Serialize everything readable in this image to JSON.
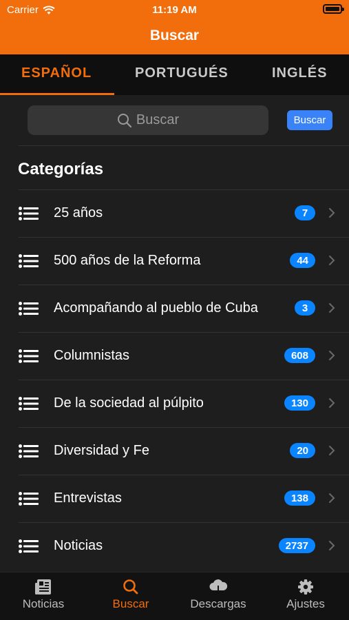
{
  "status_bar": {
    "carrier": "Carrier",
    "time": "11:19 AM"
  },
  "nav": {
    "title": "Buscar"
  },
  "tabs": [
    {
      "label": "ESPAÑOL",
      "active": true
    },
    {
      "label": "PORTUGUÉS",
      "active": false
    },
    {
      "label": "INGLÉS",
      "active": false
    }
  ],
  "search": {
    "placeholder": "Buscar",
    "button_label": "Buscar"
  },
  "section": {
    "title": "Categorías"
  },
  "categories": [
    {
      "label": "25 años",
      "count": "7"
    },
    {
      "label": "500 años de la Reforma",
      "count": "44"
    },
    {
      "label": "Acompañando al pueblo de Cuba",
      "count": "3"
    },
    {
      "label": "Columnistas",
      "count": "608"
    },
    {
      "label": "De la sociedad al púlpito",
      "count": "130"
    },
    {
      "label": "Diversidad y Fe",
      "count": "20"
    },
    {
      "label": "Entrevistas",
      "count": "138"
    },
    {
      "label": "Noticias",
      "count": "2737"
    }
  ],
  "tabbar": [
    {
      "label": "Noticias",
      "icon": "newspaper-icon",
      "active": false
    },
    {
      "label": "Buscar",
      "icon": "search-icon",
      "active": true
    },
    {
      "label": "Descargas",
      "icon": "cloud-download-icon",
      "active": false
    },
    {
      "label": "Ajustes",
      "icon": "gear-icon",
      "active": false
    }
  ],
  "colors": {
    "accent": "#f26d0c",
    "badge": "#0a84ff",
    "search_button": "#3a82f7",
    "background": "#1e1e1e"
  }
}
